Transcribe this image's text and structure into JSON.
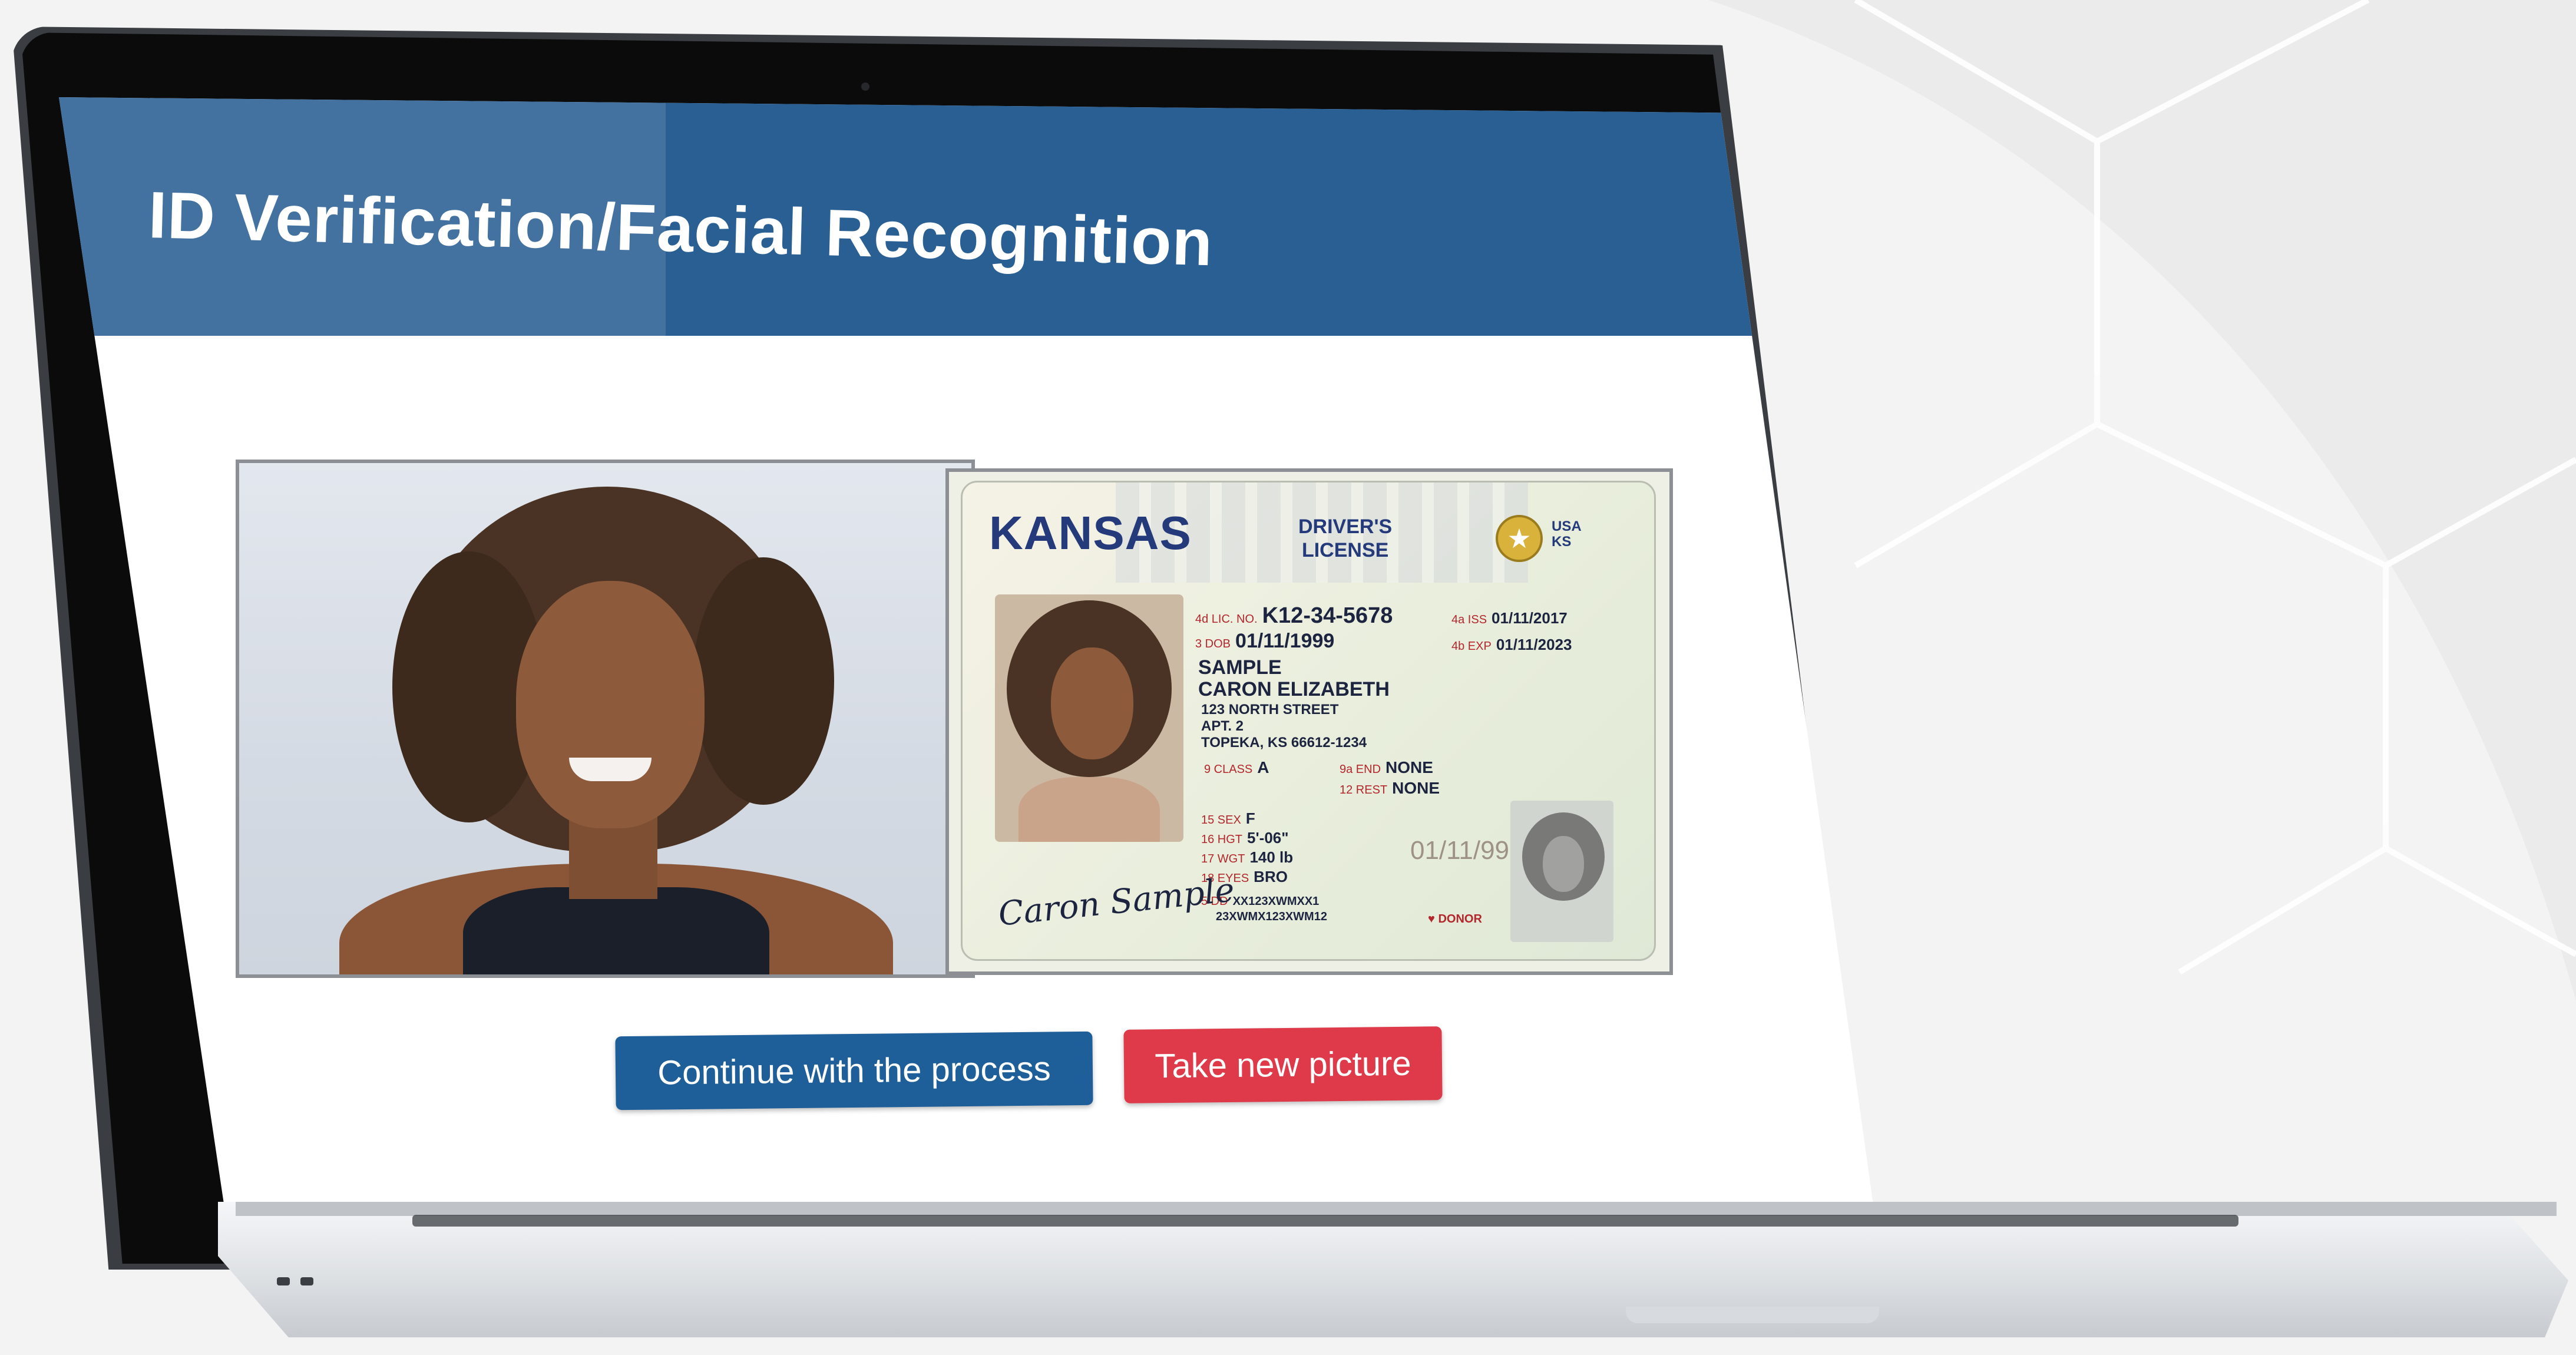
{
  "window": {
    "title": "ID Verification/Facial Recognition"
  },
  "images": {
    "selfie_alt": "Selfie photo",
    "id_alt": "Driver license"
  },
  "id_card": {
    "state": "KANSAS",
    "doc_type_line1": "DRIVER'S",
    "doc_type_line2": "LICENSE",
    "usa": "USA",
    "ks": "KS",
    "license_no_label": "4d LIC. NO.",
    "license_no": "K12-34-5678",
    "iss_label": "4a ISS",
    "iss": "01/11/2017",
    "dob_label": "3 DOB",
    "dob": "01/11/1999",
    "exp_label": "4b EXP",
    "exp": "01/11/2023",
    "last_name": "SAMPLE",
    "first_name": "CARON ELIZABETH",
    "street": "123 NORTH STREET",
    "apt": "APT. 2",
    "city": "TOPEKA, KS 66612-1234",
    "class_label": "9 CLASS",
    "class": "A",
    "end_label": "9a END",
    "end": "NONE",
    "rest_label": "12 REST",
    "rest": "NONE",
    "sex_label": "15 SEX",
    "sex": "F",
    "hgt_label": "16 HGT",
    "hgt": "5'-06\"",
    "wgt_label": "17 WGT",
    "wgt": "140 lb",
    "eyes_label": "18 EYES",
    "eyes": "BRO",
    "dd_label": "5 DD",
    "dd": "XX123XWMXX1",
    "dd2": "23XWMX123XWM12",
    "signature": "Caron Sample",
    "dob_ghost": "01/11/99",
    "donor": "DONOR"
  },
  "actions": {
    "continue_label": "Continue with the process",
    "retake_label": "Take new picture"
  },
  "colors": {
    "header": "#2a5f94",
    "continue_button": "#1f5f99",
    "retake_button": "#de3a4a"
  }
}
